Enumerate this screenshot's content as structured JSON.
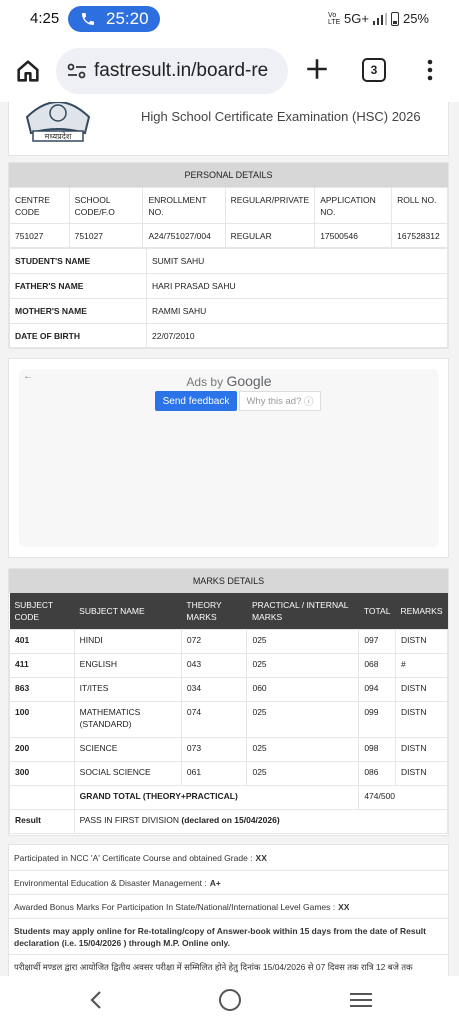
{
  "status_bar": {
    "time": "4:25",
    "call_duration": "25:20",
    "volte": "Vo LTE",
    "network": "5G+",
    "battery": "25%"
  },
  "browser": {
    "url": "fastresult.in/board-re",
    "tab_count": "3"
  },
  "header": {
    "logo_text": "मध्यप्रदेश",
    "exam_title": "High School Certificate Examination (HSC) 2026"
  },
  "personal_details": {
    "title": "PERSONAL DETAILS",
    "columns": [
      "CENTRE CODE",
      "SCHOOL CODE/F.O",
      "ENROLLMENT NO.",
      "REGULAR/PRIVATE",
      "APPLICATION NO.",
      "ROLL NO."
    ],
    "values": [
      "751027",
      "751027",
      "A24/751027/004",
      "REGULAR",
      "17500546",
      "167528312"
    ],
    "rows": [
      {
        "label": "STUDENT'S NAME",
        "value": "SUMIT SAHU"
      },
      {
        "label": "FATHER'S NAME",
        "value": "HARI PRASAD SAHU"
      },
      {
        "label": "MOTHER'S NAME",
        "value": "RAMMI SAHU"
      },
      {
        "label": "DATE OF BIRTH",
        "value": "22/07/2010"
      }
    ]
  },
  "ad": {
    "ads_by": "Ads by",
    "brand": "Google",
    "send_feedback": "Send feedback",
    "why_this_ad": "Why this ad?"
  },
  "marks_details": {
    "title": "MARKS DETAILS",
    "columns": [
      "SUBJECT CODE",
      "SUBJECT NAME",
      "THEORY MARKS",
      "PRACTICAL / INTERNAL MARKS",
      "TOTAL",
      "REMARKS"
    ],
    "rows": [
      {
        "code": "401",
        "name": "HINDI",
        "theory": "072",
        "practical": "025",
        "total": "097",
        "remarks": "DISTN"
      },
      {
        "code": "411",
        "name": "ENGLISH",
        "theory": "043",
        "practical": "025",
        "total": "068",
        "remarks": "#"
      },
      {
        "code": "863",
        "name": "IT/ITES",
        "theory": "034",
        "practical": "060",
        "total": "094",
        "remarks": "DISTN"
      },
      {
        "code": "100",
        "name": "MATHEMATICS (STANDARD)",
        "theory": "074",
        "practical": "025",
        "total": "099",
        "remarks": "DISTN"
      },
      {
        "code": "200",
        "name": "SCIENCE",
        "theory": "073",
        "practical": "025",
        "total": "098",
        "remarks": "DISTN"
      },
      {
        "code": "300",
        "name": "SOCIAL SCIENCE",
        "theory": "061",
        "practical": "025",
        "total": "086",
        "remarks": "DISTN"
      }
    ],
    "grand_total_label": "GRAND TOTAL (THEORY+PRACTICAL)",
    "grand_total_value": "474/500",
    "result_label": "Result",
    "result_value": "PASS IN FIRST DIVISION",
    "result_declared": "(declared on 15/04/2026)"
  },
  "notes": {
    "ncc_text": "Participated in NCC 'A' Certificate Course and obtained Grade :",
    "ncc_value": "XX",
    "env_text": "Environmental Education & Disaster Management :",
    "env_value": "A+",
    "bonus_text": "Awarded Bonus Marks For Participation In State/National/International Level Games :",
    "bonus_value": "XX",
    "retotal_text": "Students may apply online for Re-totaling/copy of Answer-book within 15 days from the date of Result declaration (i.e. 15/04/2026 ) through M.P. Online only.",
    "hindi_text": "परीक्षार्थी मण्डल द्वारा आयोजित द्वितीय अवसर परीक्षा में सम्मिलित होने हेतु दिनांक 15/04/2026 से 07 दिवस तक रात्रि 12 बजे तक"
  }
}
